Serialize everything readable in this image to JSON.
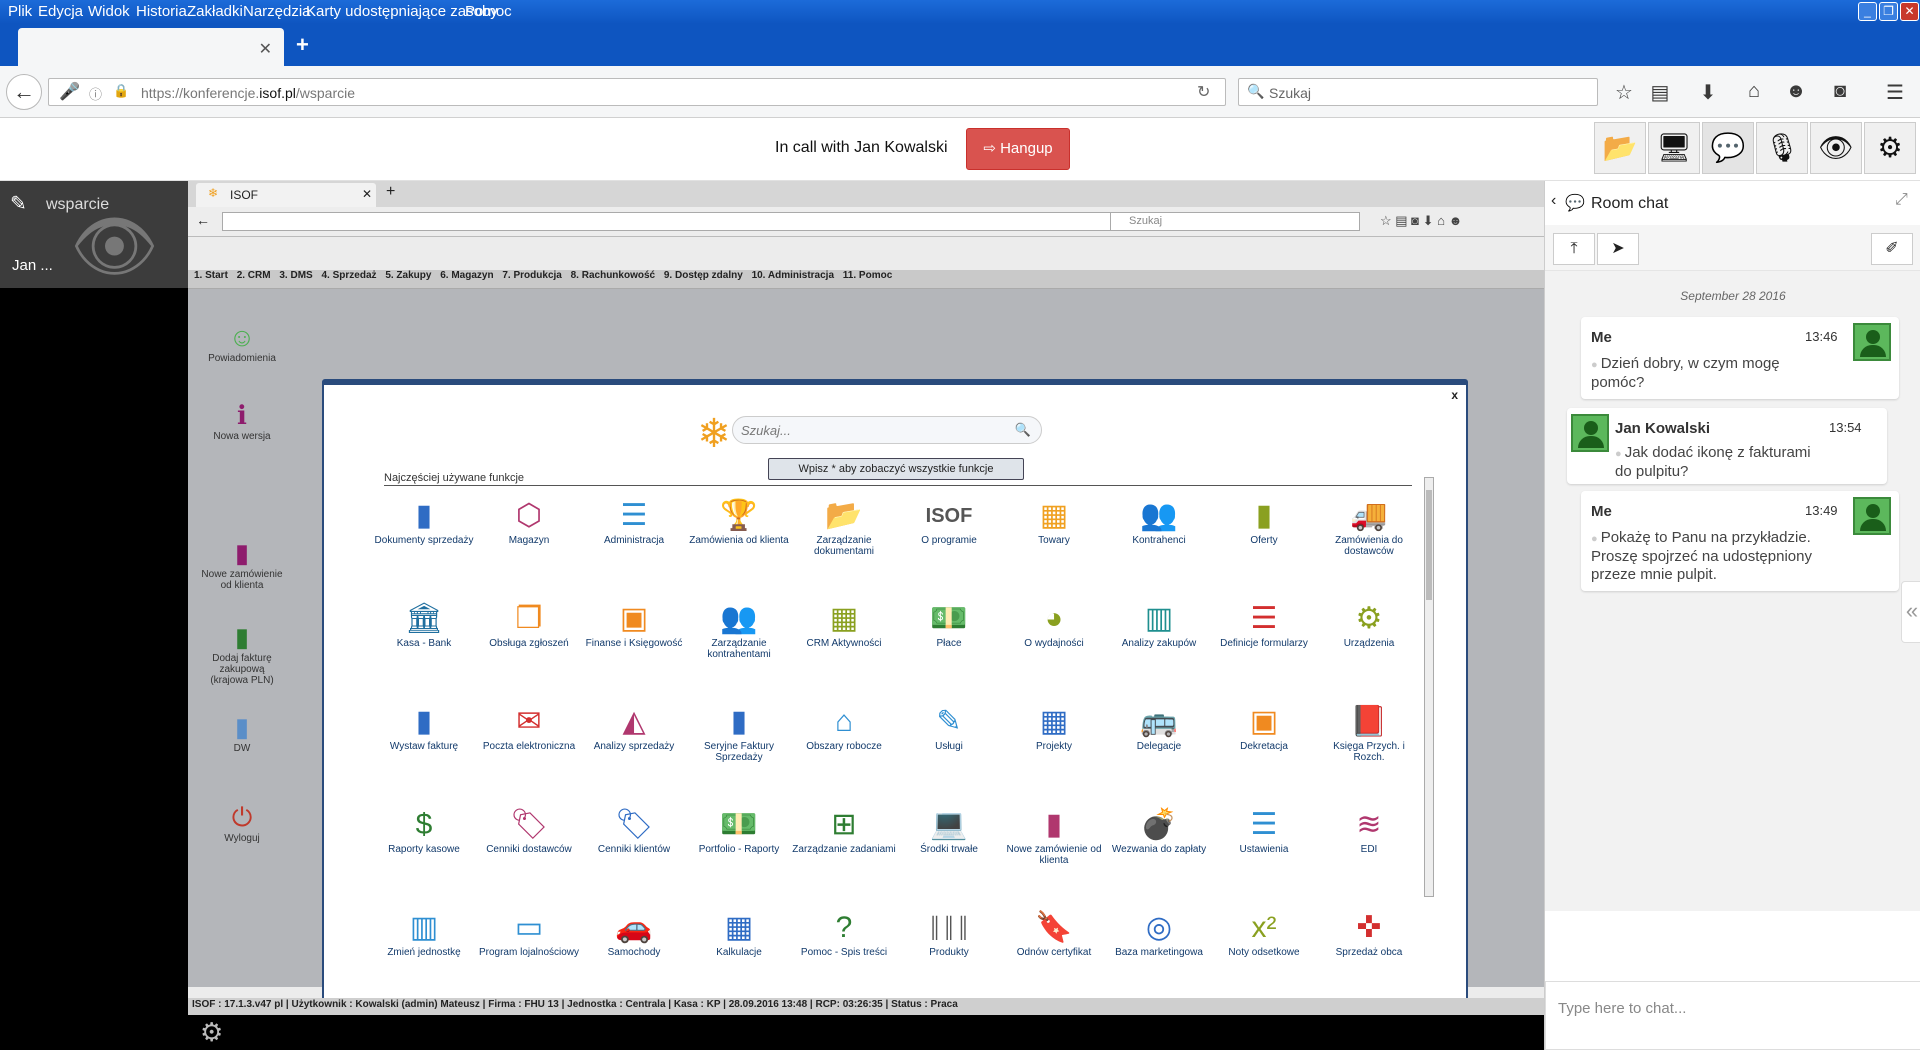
{
  "menubar": {
    "items": [
      "Plik",
      "Edycja",
      "Widok",
      "Historia",
      "Zakładki",
      "Narzędzia",
      "Karty udostępniające zasoby",
      "Pomoc"
    ]
  },
  "browser": {
    "url_prefix": "https://konferencje.",
    "url_host": "isof.pl",
    "url_path": "/wsparcie",
    "search_placeholder": "Szukaj"
  },
  "call": {
    "status": "In call with Jan Kowalski",
    "hangup_label": "Hangup"
  },
  "left_panel": {
    "room": "wsparcie",
    "user": "Jan ..."
  },
  "shared_screen": {
    "tab_title": "ISOF",
    "inner_search": "Szukaj",
    "menu": [
      "1. Start",
      "2. CRM",
      "3. DMS",
      "4. Sprzedaż",
      "5. Zakupy",
      "6. Magazyn",
      "7. Produkcja",
      "8. Rachunkowość",
      "9. Dostęp zdalny",
      "10. Administracja",
      "11. Pomoc"
    ],
    "side_items": [
      {
        "label": "Powiadomienia",
        "icon": "smile-icon",
        "color": "#4caf50"
      },
      {
        "label": "Nowa wersja",
        "icon": "info-icon",
        "color": "#8e1c6d"
      },
      {
        "label": "Nowe zamówienie od klienta",
        "icon": "zk-doc-icon",
        "color": "#8e1c6d"
      },
      {
        "label": "Dodaj fakturę zakupową (krajowa PLN)",
        "icon": "doc-icon",
        "color": "#2e7d32"
      },
      {
        "label": "DW",
        "icon": "dms-icon",
        "color": "#5a8ec8"
      },
      {
        "label": "Wyloguj",
        "icon": "power-icon",
        "color": "#c0392b"
      }
    ],
    "modal": {
      "close": "x",
      "search_placeholder": "Szukaj...",
      "hint": "Wpisz * aby zobaczyć wszystkie funkcje",
      "heading": "Najczęściej używane funkcje",
      "tiles": [
        {
          "label": "Dokumenty sprzedaży",
          "icon": "document-icon",
          "glyph": "▮",
          "color": "#2f6cc4"
        },
        {
          "label": "Magazyn",
          "icon": "cube-icon",
          "glyph": "⬡",
          "color": "#b0376e"
        },
        {
          "label": "Administracja",
          "icon": "list-icon",
          "glyph": "☰",
          "color": "#2f8fd2"
        },
        {
          "label": "Zamówienia od klienta",
          "icon": "trophy-icon",
          "glyph": "🏆",
          "color": "#1f8f8f"
        },
        {
          "label": "Zarządzanie dokumentami",
          "icon": "folder-icon",
          "glyph": "📂",
          "color": "#1f8f8f"
        },
        {
          "label": "O programie",
          "icon": "isof-logo-icon",
          "glyph": "ISOF",
          "color": "#555"
        },
        {
          "label": "Towary",
          "icon": "boxes-icon",
          "glyph": "▦",
          "color": "#f0a020"
        },
        {
          "label": "Kontrahenci",
          "icon": "people-icon",
          "glyph": "👥",
          "color": "#f08a20"
        },
        {
          "label": "Oferty",
          "icon": "offer-doc-icon",
          "glyph": "▮",
          "color": "#8aa020"
        },
        {
          "label": "Zamówienia do dostawców",
          "icon": "truck-icon",
          "glyph": "🚚",
          "color": "#2f6cc4"
        },
        {
          "label": "Kasa - Bank",
          "icon": "bank-icon",
          "glyph": "🏛",
          "color": "#1f6f9f"
        },
        {
          "label": "Obsługa zgłoszeń",
          "icon": "copy-icon",
          "glyph": "❐",
          "color": "#f08a20"
        },
        {
          "label": "Finanse i Księgowość",
          "icon": "archive-icon",
          "glyph": "▣",
          "color": "#f08a20"
        },
        {
          "label": "Zarządzanie kontrahentami",
          "icon": "group-icon",
          "glyph": "👥",
          "color": "#f08a20"
        },
        {
          "label": "CRM Aktywności",
          "icon": "calendar-icon",
          "glyph": "▦",
          "color": "#8aa020"
        },
        {
          "label": "Płace",
          "icon": "money-icon",
          "glyph": "💵",
          "color": "#2f6cc4"
        },
        {
          "label": "O wydajności",
          "icon": "palette-icon",
          "glyph": "◕",
          "color": "#8aa020"
        },
        {
          "label": "Analizy zakupów",
          "icon": "bar-chart-icon",
          "glyph": "▥",
          "color": "#1f8f8f"
        },
        {
          "label": "Definicje formularzy",
          "icon": "form-list-icon",
          "glyph": "☰",
          "color": "#d32f2f"
        },
        {
          "label": "Urządzenia",
          "icon": "gears-icon",
          "glyph": "⚙",
          "color": "#8aa020"
        },
        {
          "label": "Wystaw fakturę",
          "icon": "invoice-add-icon",
          "glyph": "▮",
          "color": "#2f6cc4"
        },
        {
          "label": "Poczta elektroniczna",
          "icon": "envelope-icon",
          "glyph": "✉",
          "color": "#d32f2f"
        },
        {
          "label": "Analizy sprzedaży",
          "icon": "area-chart-icon",
          "glyph": "◭",
          "color": "#b0376e"
        },
        {
          "label": "Seryjne Faktury Sprzedaży",
          "icon": "series-doc-icon",
          "glyph": "▮",
          "color": "#2f6cc4"
        },
        {
          "label": "Obszary robocze",
          "icon": "home-icon",
          "glyph": "⌂",
          "color": "#2f8fd2"
        },
        {
          "label": "Usługi",
          "icon": "edit-icon",
          "glyph": "✎",
          "color": "#2f8fd2"
        },
        {
          "label": "Projekty",
          "icon": "grid-icon",
          "glyph": "▦",
          "color": "#2f6cc4"
        },
        {
          "label": "Delegacje",
          "icon": "bus-icon",
          "glyph": "🚌",
          "color": "#2f6cc4"
        },
        {
          "label": "Dekretacja",
          "icon": "archive-icon",
          "glyph": "▣",
          "color": "#f08a20"
        },
        {
          "label": "Księga Przych. i Rozch.",
          "icon": "book-icon",
          "glyph": "📕",
          "color": "#b0376e"
        },
        {
          "label": "Raporty kasowe",
          "icon": "dollar-icon",
          "glyph": "$",
          "color": "#2e7d32"
        },
        {
          "label": "Cenniki dostawców",
          "icon": "tags-icon",
          "glyph": "🏷",
          "color": "#b0376e"
        },
        {
          "label": "Cenniki klientów",
          "icon": "tag-icon",
          "glyph": "🏷",
          "color": "#2f6cc4"
        },
        {
          "label": "Portfolio - Raporty",
          "icon": "money-icon",
          "glyph": "💵",
          "color": "#1f8f8f"
        },
        {
          "label": "Zarządzanie zadaniami",
          "icon": "sitemap-icon",
          "glyph": "⊞",
          "color": "#2e7d32"
        },
        {
          "label": "Środki trwałe",
          "icon": "laptop-icon",
          "glyph": "💻",
          "color": "#2f8fd2"
        },
        {
          "label": "Nowe zamówienie od klienta",
          "icon": "zk-doc-icon",
          "glyph": "▮",
          "color": "#b0376e"
        },
        {
          "label": "Wezwania do zapłaty",
          "icon": "bomb-icon",
          "glyph": "💣",
          "color": "#d32f2f"
        },
        {
          "label": "Ustawienia",
          "icon": "list-icon",
          "glyph": "☰",
          "color": "#2f8fd2"
        },
        {
          "label": "EDI",
          "icon": "stack-icon",
          "glyph": "≋",
          "color": "#b0376e"
        },
        {
          "label": "Zmień jednostkę",
          "icon": "building-icon",
          "glyph": "▥",
          "color": "#2f8fd2"
        },
        {
          "label": "Program lojalnościowy",
          "icon": "card-icon",
          "glyph": "▭",
          "color": "#2f8fd2"
        },
        {
          "label": "Samochody",
          "icon": "car-icon",
          "glyph": "🚗",
          "color": "#1f8f8f"
        },
        {
          "label": "Kalkulacje",
          "icon": "table-icon",
          "glyph": "▦",
          "color": "#2f6cc4"
        },
        {
          "label": "Pomoc - Spis treści",
          "icon": "help-icon",
          "glyph": "?",
          "color": "#2e7d32"
        },
        {
          "label": "Produkty",
          "icon": "barcode-icon",
          "glyph": "║║║",
          "color": "#555"
        },
        {
          "label": "Odnów certyfikat",
          "icon": "bookmark-icon",
          "glyph": "🔖",
          "color": "#b0376e"
        },
        {
          "label": "Baza marketingowa",
          "icon": "rings-icon",
          "glyph": "◎",
          "color": "#2f6cc4"
        },
        {
          "label": "Noty odsetkowe",
          "icon": "superscript-icon",
          "glyph": "x²",
          "color": "#8aa020"
        },
        {
          "label": "Sprzedaż obca",
          "icon": "crosshair-icon",
          "glyph": "✜",
          "color": "#d32f2f"
        }
      ]
    },
    "statusbar": "ISOF : 17.1.3.v47 pl  |  Użytkownik : Kowalski (admin) Mateusz  |  Firma : FHU 13  |  Jednostka : Centrala  |  Kasa : KP  |  28.09.2016 13:48  |  RCP: 03:26:35  |  Status : Praca"
  },
  "chat": {
    "title": "Room chat",
    "date": "September 28 2016",
    "messages": [
      {
        "who": "Me",
        "time": "13:46",
        "text": "Dzień dobry, w czym mogę pomóc?"
      },
      {
        "who": "Jan Kowalski",
        "time": "13:54",
        "text": "Jak dodać ikonę z fakturami do pulpitu?"
      },
      {
        "who": "Me",
        "time": "13:49",
        "text": "Pokażę to Panu na przykładzie. Proszę spojrzeć na udostępniony przeze mnie pulpit."
      }
    ],
    "input_placeholder": "Type here to chat..."
  }
}
